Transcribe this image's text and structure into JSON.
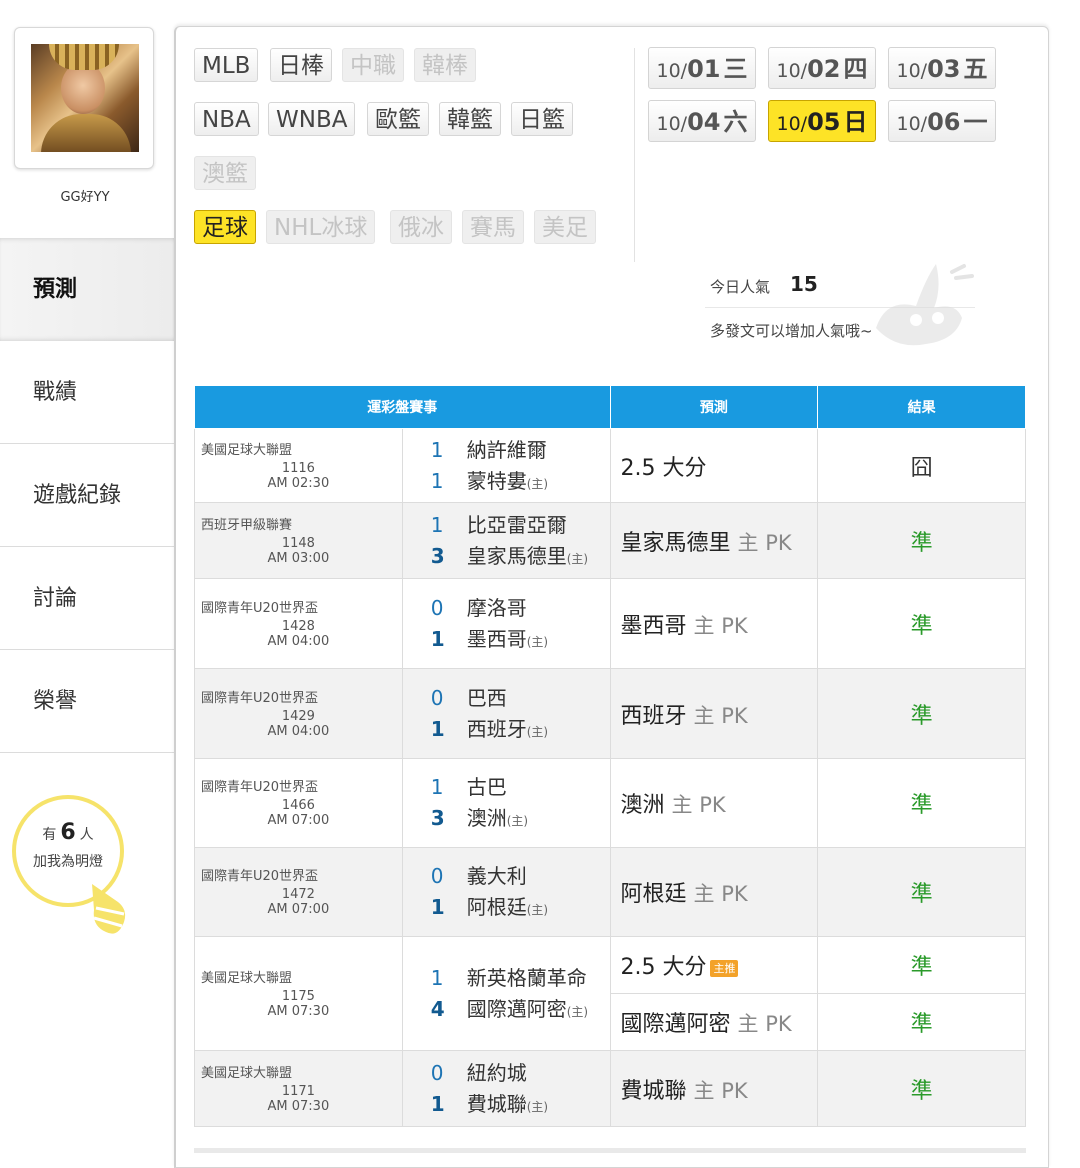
{
  "user": {
    "name": "GG好YY"
  },
  "nav": [
    {
      "id": "predict",
      "label": "預測",
      "active": true
    },
    {
      "id": "record",
      "label": "戰績"
    },
    {
      "id": "game-log",
      "label": "遊戲紀錄"
    },
    {
      "id": "discussion",
      "label": "討論"
    },
    {
      "id": "honor",
      "label": "榮譽"
    }
  ],
  "fans": {
    "prefix": "有",
    "count": "6",
    "suffix": "人",
    "line2": "加我為明燈"
  },
  "sports": {
    "row1": [
      "MLB",
      "日棒",
      "中職",
      "韓棒"
    ],
    "row2": [
      "NBA",
      "WNBA",
      "歐籃",
      "韓籃",
      "日籃"
    ],
    "row3": [
      "澳籃"
    ],
    "row4": [
      "足球",
      "NHL冰球",
      "俄冰",
      "賽馬",
      "美足"
    ]
  },
  "dates": [
    {
      "md": "10/",
      "d": "01",
      "w": "三"
    },
    {
      "md": "10/",
      "d": "02",
      "w": "四"
    },
    {
      "md": "10/",
      "d": "03",
      "w": "五"
    },
    {
      "md": "10/",
      "d": "04",
      "w": "六"
    },
    {
      "md": "10/",
      "d": "05",
      "w": "日"
    },
    {
      "md": "10/",
      "d": "06",
      "w": "一"
    }
  ],
  "popularity": {
    "label": "今日人氣",
    "value": "15",
    "hint": "多發文可以增加人氣哦~"
  },
  "table": {
    "headers": {
      "match": "運彩盤賽事",
      "prediction": "預測",
      "result": "結果"
    },
    "home_mark": "(主)",
    "rows": [
      {
        "league": "美國足球大聯盟",
        "num": "1116",
        "time": "AM 02:30",
        "away": {
          "score": "1",
          "team": "納許維爾"
        },
        "homeTeam": {
          "score": "1",
          "team": "蒙特婁"
        },
        "pred": "2.5 大分",
        "pk": "",
        "result": "囧"
      },
      {
        "league": "西班牙甲級聯賽",
        "num": "1148",
        "time": "AM 03:00",
        "away": {
          "score": "1",
          "team": "比亞雷亞爾"
        },
        "homeTeam": {
          "score": "3",
          "team": "皇家馬德里"
        },
        "pred": "皇家馬德里",
        "pk": "主 PK",
        "result": "準"
      },
      {
        "league": "國際青年U20世界盃",
        "num": "1428",
        "time": "AM 04:00",
        "away": {
          "score": "0",
          "team": "摩洛哥"
        },
        "homeTeam": {
          "score": "1",
          "team": "墨西哥"
        },
        "pred": "墨西哥",
        "pk": "主 PK",
        "result": "準"
      },
      {
        "league": "國際青年U20世界盃",
        "num": "1429",
        "time": "AM 04:00",
        "away": {
          "score": "0",
          "team": "巴西"
        },
        "homeTeam": {
          "score": "1",
          "team": "西班牙"
        },
        "pred": "西班牙",
        "pk": "主 PK",
        "result": "準"
      },
      {
        "league": "國際青年U20世界盃",
        "num": "1466",
        "time": "AM 07:00",
        "away": {
          "score": "1",
          "team": "古巴"
        },
        "homeTeam": {
          "score": "3",
          "team": "澳洲"
        },
        "pred": "澳洲",
        "pk": "主 PK",
        "result": "準"
      },
      {
        "league": "國際青年U20世界盃",
        "num": "1472",
        "time": "AM 07:00",
        "away": {
          "score": "0",
          "team": "義大利"
        },
        "homeTeam": {
          "score": "1",
          "team": "阿根廷"
        },
        "pred": "阿根廷",
        "pk": "主 PK",
        "result": "準"
      },
      {
        "league": "美國足球大聯盟",
        "num": "1175",
        "time": "AM 07:30",
        "away": {
          "score": "1",
          "team": "新英格蘭革命"
        },
        "homeTeam": {
          "score": "4",
          "team": "國際邁阿密"
        },
        "pred": "2.5 大分",
        "badge": "主推",
        "result": "準",
        "pred2": "國際邁阿密",
        "pk2": "主 PK",
        "result2": "準"
      },
      {
        "league": "美國足球大聯盟",
        "num": "1171",
        "time": "AM 07:30",
        "away": {
          "score": "0",
          "team": "紐約城"
        },
        "homeTeam": {
          "score": "1",
          "team": "費城聯"
        },
        "pred": "費城聯",
        "pk": "主 PK",
        "result": "準"
      }
    ]
  },
  "colors": {
    "header": "#199ae0",
    "selected": "#fde326",
    "correct": "#2a9a2a",
    "score": "#1d74b4"
  }
}
